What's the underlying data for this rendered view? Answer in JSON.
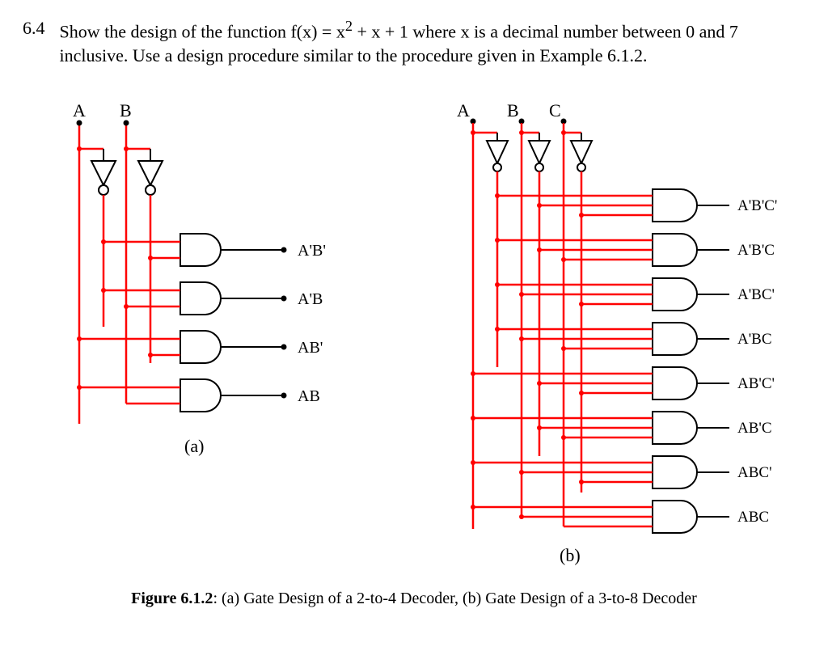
{
  "problem": {
    "number": "6.4",
    "text_prefix": "Show the design of the function f(x) = x",
    "text_mid1": " + x + 1 where x is a decimal number between 0 and 7 inclusive.   Use a design procedure similar to the procedure given in ",
    "text_mid2": "Example 6.1.2.",
    "exponent": "2"
  },
  "diagram_a": {
    "input_A": "A",
    "input_B": "B",
    "outputs": [
      "A'B'",
      "A'B",
      "AB'",
      "AB"
    ],
    "label": "(a)"
  },
  "diagram_b": {
    "input_A": "A",
    "input_B": "B",
    "input_C": "C",
    "outputs": [
      "A'B'C'",
      "A'B'C",
      "A'BC'",
      "A'BC",
      "AB'C'",
      "AB'C",
      "ABC'",
      "ABC"
    ],
    "label": "(b)"
  },
  "caption": {
    "label": "Figure 6.1.2",
    "text": ": (a) Gate Design of a 2-to-4 Decoder, (b) Gate Design of a 3-to-8 Decoder"
  }
}
